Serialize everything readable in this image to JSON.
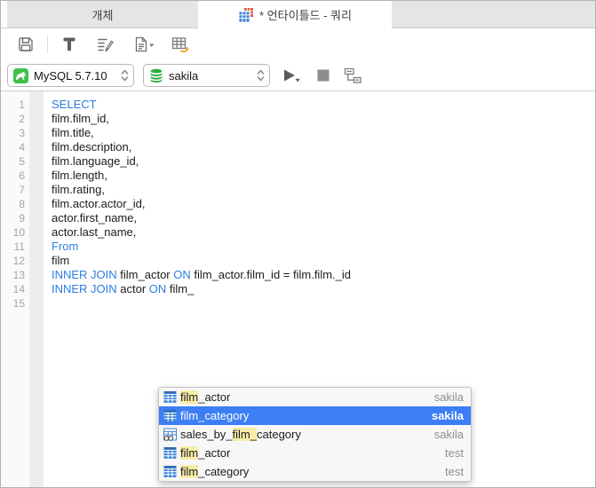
{
  "tabs": {
    "objects": "개체",
    "query": "* 언타이틀드 - 쿼리",
    "query_icon": "query-table-icon"
  },
  "toolbar": {
    "icons": [
      "save-icon",
      "query-builder-icon",
      "beautify-sql-icon",
      "export-document-icon",
      "table-transfer-icon"
    ]
  },
  "connection_bar": {
    "connection_select": {
      "value": "MySQL 5.7.10",
      "icon": "mysql-icon"
    },
    "database_select": {
      "value": "sakila",
      "icon": "database-icon"
    },
    "actions": [
      "run-icon",
      "stop-icon",
      "explain-icon"
    ]
  },
  "editor": {
    "line_count": 15,
    "lines": [
      {
        "num": 1,
        "tokens": [
          {
            "text": "SELECT",
            "keyword": true
          }
        ]
      },
      {
        "num": 2,
        "tokens": [
          {
            "text": "film.film_id,"
          }
        ]
      },
      {
        "num": 3,
        "tokens": [
          {
            "text": "film.title,"
          }
        ]
      },
      {
        "num": 4,
        "tokens": [
          {
            "text": "film.description,"
          }
        ]
      },
      {
        "num": 5,
        "tokens": [
          {
            "text": "film.language_id,"
          }
        ]
      },
      {
        "num": 6,
        "tokens": [
          {
            "text": "film.length,"
          }
        ]
      },
      {
        "num": 7,
        "tokens": [
          {
            "text": "film.rating,"
          }
        ]
      },
      {
        "num": 8,
        "tokens": [
          {
            "text": "film.actor.actor_id,"
          }
        ]
      },
      {
        "num": 9,
        "tokens": [
          {
            "text": "actor.first_name,"
          }
        ]
      },
      {
        "num": 10,
        "tokens": [
          {
            "text": "actor.last_name,"
          }
        ]
      },
      {
        "num": 11,
        "tokens": [
          {
            "text": "From",
            "keyword": true
          }
        ]
      },
      {
        "num": 12,
        "tokens": [
          {
            "text": "film"
          }
        ]
      },
      {
        "num": 13,
        "tokens": [
          {
            "text": "INNER JOIN",
            "keyword": true
          },
          {
            "text": " film_actor "
          },
          {
            "text": "ON",
            "keyword": true
          },
          {
            "text": " film_actor.film_id = film.film._id"
          }
        ]
      },
      {
        "num": 14,
        "tokens": [
          {
            "text": "INNER JOIN",
            "keyword": true
          },
          {
            "text": " actor "
          },
          {
            "text": "ON",
            "keyword": true
          },
          {
            "text": " film_"
          }
        ]
      },
      {
        "num": 15,
        "tokens": []
      }
    ]
  },
  "autocomplete": {
    "items": [
      {
        "icon": "table-icon",
        "pre": "",
        "match": "film",
        "post": "_actor",
        "db": "sakila",
        "selected": false
      },
      {
        "icon": "table-icon",
        "pre": "",
        "match": "film",
        "post": "_category",
        "db": "sakila",
        "selected": true
      },
      {
        "icon": "view-icon",
        "pre": "sales_by_",
        "match": "film_",
        "post": "category",
        "db": "sakila",
        "selected": false
      },
      {
        "icon": "table-icon",
        "pre": "",
        "match": "film",
        "post": "_actor",
        "db": "test",
        "selected": false
      },
      {
        "icon": "table-icon",
        "pre": "",
        "match": "film",
        "post": "_category",
        "db": "test",
        "selected": false
      }
    ]
  },
  "colors": {
    "selection_blue": "#3d7ef4",
    "keyword_blue": "#2d7de0",
    "match_yellow": "#f8eca8",
    "mysql_green": "#3ec14b",
    "db_green": "#2fae3e",
    "table_icon_blue": "#3f86d8",
    "query_icon_red": "#e2593d",
    "arrow_orange": "#f5a623",
    "tab_gray": "#e5e5e5"
  }
}
